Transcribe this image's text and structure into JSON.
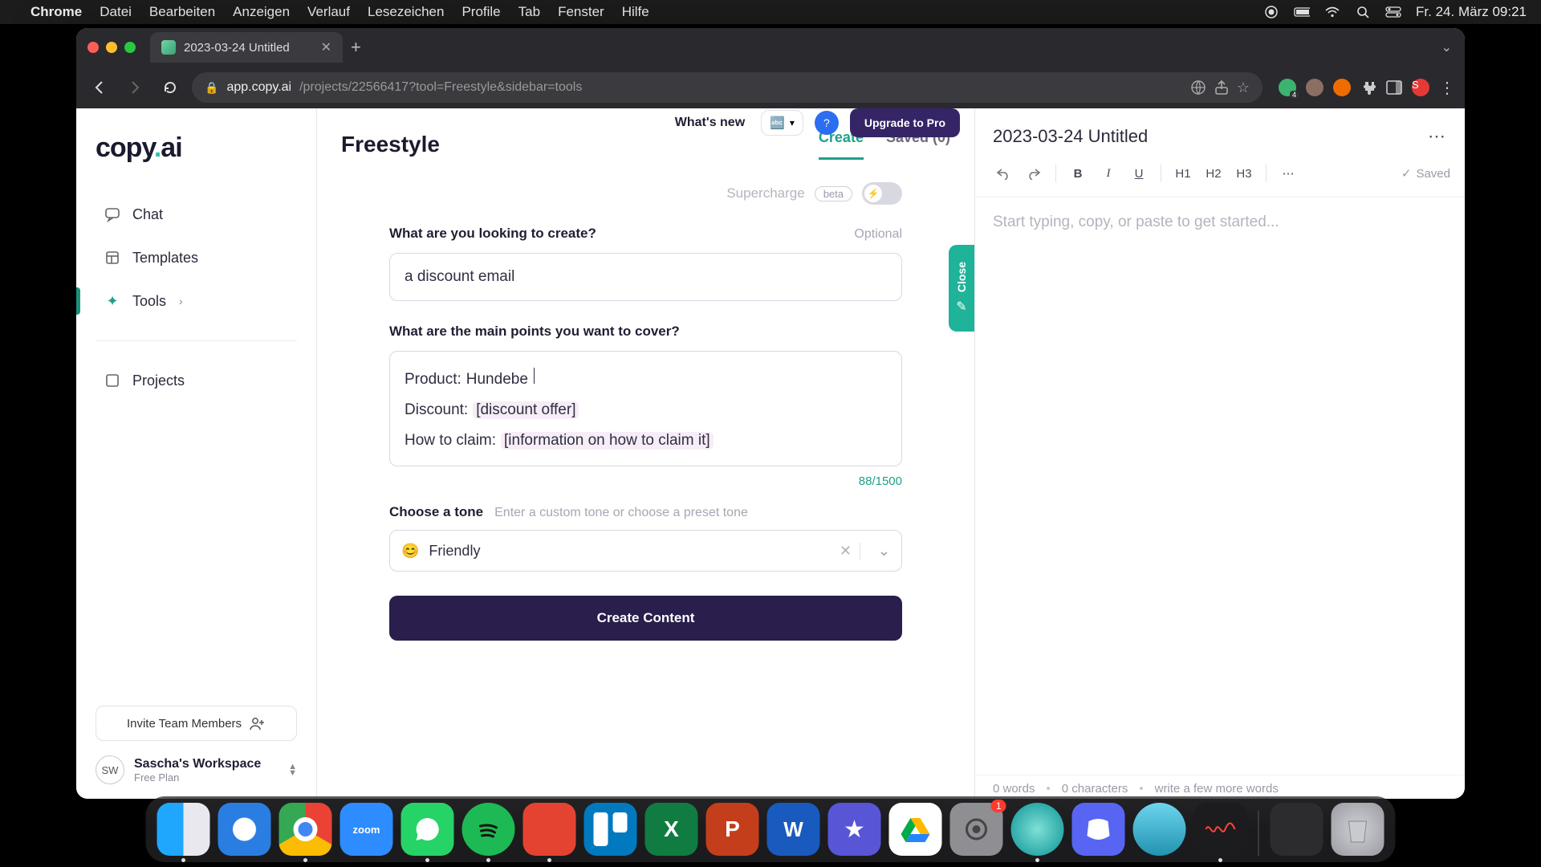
{
  "menubar": {
    "app": "Chrome",
    "items": [
      "Datei",
      "Bearbeiten",
      "Anzeigen",
      "Verlauf",
      "Lesezeichen",
      "Profile",
      "Tab",
      "Fenster",
      "Hilfe"
    ],
    "clock": "Fr. 24. März  09:21"
  },
  "browser": {
    "tab_title": "2023-03-24 Untitled",
    "url_host": "app.copy.ai",
    "url_path": "/projects/22566417?tool=Freestyle&sidebar=tools"
  },
  "sidebar": {
    "logo_a": "copy",
    "logo_b": "ai",
    "items": [
      {
        "label": "Chat"
      },
      {
        "label": "Templates"
      },
      {
        "label": "Tools"
      },
      {
        "label": "Projects"
      }
    ],
    "invite": "Invite Team Members",
    "workspace_initials": "SW",
    "workspace_name": "Sascha's Workspace",
    "workspace_plan": "Free Plan"
  },
  "header_strip": {
    "whats_new": "What's new",
    "upgrade": "Upgrade to Pro"
  },
  "page": {
    "title": "Freestyle",
    "tab_create": "Create",
    "tab_saved": "Saved (0)",
    "supercharge": "Supercharge",
    "beta": "beta",
    "q1_label": "What are you looking to create?",
    "q1_optional": "Optional",
    "q1_value": "a discount email",
    "q2_label": "What are the main points you want to cover?",
    "points": {
      "product_key": "Product:",
      "product_val": "Hundebe",
      "discount_key": "Discount:",
      "discount_val": "[discount offer]",
      "claim_key": "How to claim:",
      "claim_val": "[information on how to claim it]"
    },
    "counter": "88/1500",
    "tone_label": "Choose a tone",
    "tone_hint": "Enter a custom tone or choose a preset tone",
    "tone_emoji": "😊",
    "tone_value": "Friendly",
    "create_btn": "Create Content"
  },
  "editor": {
    "doc_title": "2023-03-24 Untitled",
    "h1": "H1",
    "h2": "H2",
    "h3": "H3",
    "saved": "Saved",
    "placeholder": "Start typing, copy, or paste to get started...",
    "footer_words": "0 words",
    "footer_chars": "0 characters",
    "footer_hint": "write a few more words"
  },
  "close_handle": "Close",
  "dock": {
    "badge": "1"
  }
}
